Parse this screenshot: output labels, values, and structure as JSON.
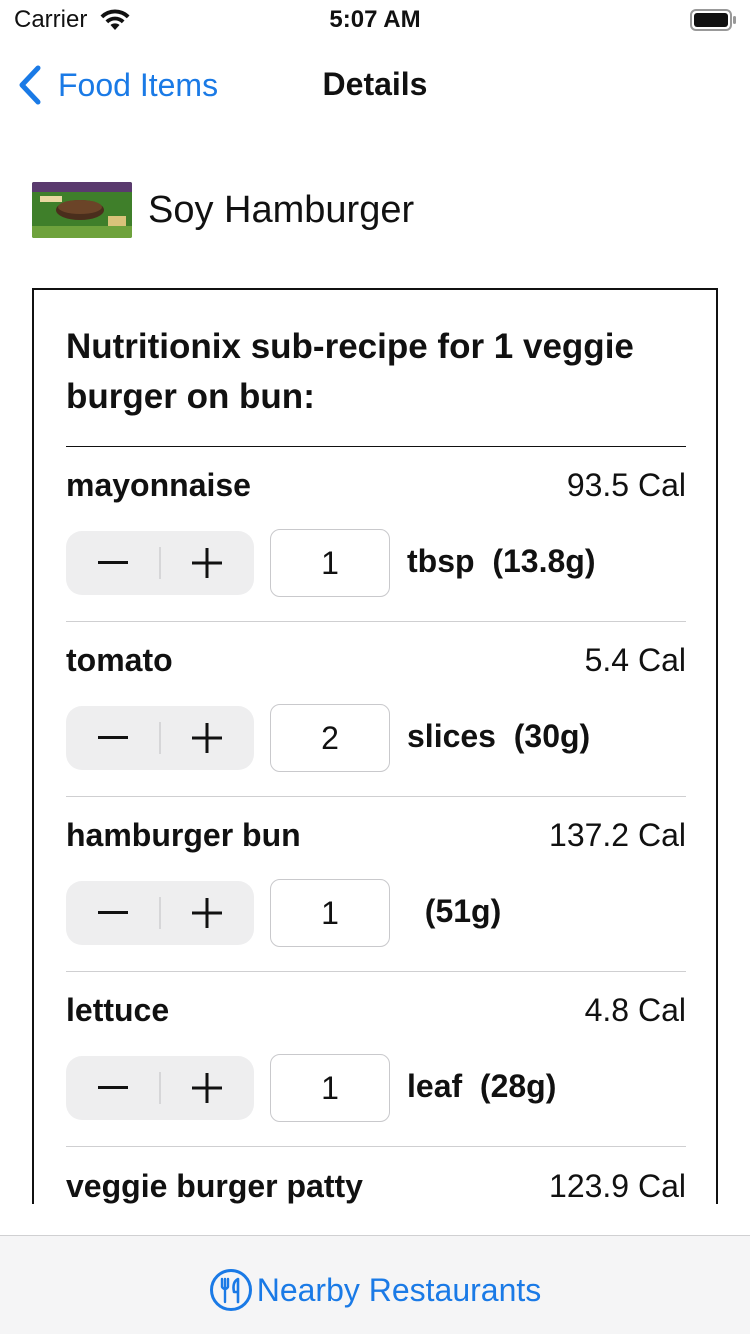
{
  "status_bar": {
    "carrier": "Carrier",
    "time": "5:07 AM"
  },
  "nav": {
    "back_label": "Food Items",
    "title": "Details"
  },
  "food": {
    "name": "Soy Hamburger",
    "image_icon": "food-photo"
  },
  "recipe": {
    "title": "Nutritionix sub-recipe for 1 veggie burger on bun:",
    "ingredients": [
      {
        "name": "mayonnaise",
        "calories": "93.5 Cal",
        "quantity": "1",
        "unit": "tbsp  (13.8g)"
      },
      {
        "name": "tomato",
        "calories": "5.4 Cal",
        "quantity": "2",
        "unit": "slices  (30g)"
      },
      {
        "name": "hamburger bun",
        "calories": "137.2 Cal",
        "quantity": "1",
        "unit": "  (51g)"
      },
      {
        "name": "lettuce",
        "calories": "4.8 Cal",
        "quantity": "1",
        "unit": "leaf  (28g)"
      },
      {
        "name": "veggie burger patty",
        "calories": "123.9 Cal"
      }
    ]
  },
  "toolbar": {
    "nearby_label": "Nearby Restaurants",
    "nearby_icon": "fork-knife-icon"
  },
  "colors": {
    "accent": "#1a7ae6",
    "stepper_bg": "#eeeeef",
    "toolbar_bg": "#f5f5f6"
  }
}
